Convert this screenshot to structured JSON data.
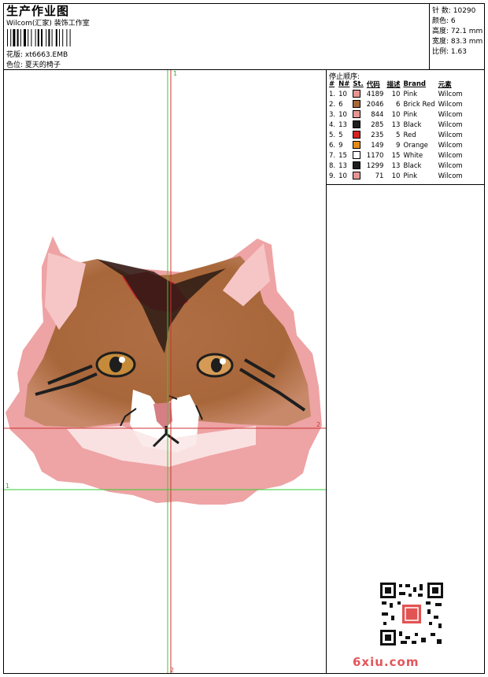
{
  "header": {
    "title": "生产作业图",
    "company": "Wilcom(汇家) 装饰工作室",
    "design_label": "花版: xt6663.EMB",
    "color_label": "色位: 夏天的椅子"
  },
  "stats": {
    "stitches": "针 数: 10290",
    "colors": "颜色: 6",
    "height": "高度: 72.1 mm",
    "width": "宽度: 83.3 mm",
    "scale": "比例: 1.63"
  },
  "palette": {
    "title": "停止顺序:",
    "headers": [
      "#",
      "N#",
      "St.",
      "代码",
      "描述",
      "Brand",
      "元素"
    ],
    "rows": [
      {
        "seq": "1.",
        "needle": "10",
        "color": "#e79494",
        "st": "4189",
        "code": "10",
        "desc": "Pink",
        "brand": "Wilcom"
      },
      {
        "seq": "2.",
        "needle": "6",
        "color": "#a8673a",
        "st": "2046",
        "code": "6",
        "desc": "Brick Red",
        "brand": "Wilcom"
      },
      {
        "seq": "3.",
        "needle": "10",
        "color": "#e79494",
        "st": "844",
        "code": "10",
        "desc": "Pink",
        "brand": "Wilcom"
      },
      {
        "seq": "4.",
        "needle": "13",
        "color": "#1e1e1e",
        "st": "285",
        "code": "13",
        "desc": "Black",
        "brand": "Wilcom"
      },
      {
        "seq": "5.",
        "needle": "5",
        "color": "#d52121",
        "st": "235",
        "code": "5",
        "desc": "Red",
        "brand": "Wilcom"
      },
      {
        "seq": "6.",
        "needle": "9",
        "color": "#e68a16",
        "st": "149",
        "code": "9",
        "desc": "Orange",
        "brand": "Wilcom"
      },
      {
        "seq": "7.",
        "needle": "15",
        "color": "#ffffff",
        "st": "1170",
        "code": "15",
        "desc": "White",
        "brand": "Wilcom"
      },
      {
        "seq": "8.",
        "needle": "13",
        "color": "#1e1e1e",
        "st": "1299",
        "code": "13",
        "desc": "Black",
        "brand": "Wilcom"
      },
      {
        "seq": "9.",
        "needle": "10",
        "color": "#e79494",
        "st": "71",
        "code": "10",
        "desc": "Pink",
        "brand": "Wilcom"
      }
    ]
  },
  "canvas": {
    "axis_label_top": "1",
    "axis_label_bottom": "2",
    "axis_label_left": "1",
    "axis_label_right": "2"
  },
  "watermark": {
    "site": "6xiu.com"
  }
}
